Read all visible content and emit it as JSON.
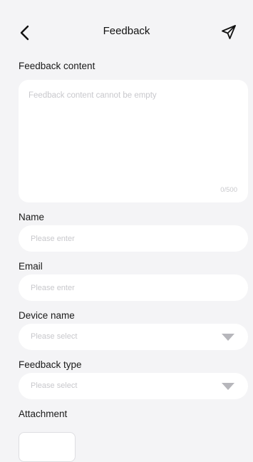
{
  "header": {
    "title": "Feedback",
    "back_icon": "chevron-left-icon",
    "send_icon": "send-icon"
  },
  "content": {
    "label": "Feedback content",
    "placeholder": "Feedback content cannot be empty",
    "value": "",
    "counter": "0/500"
  },
  "name": {
    "label": "Name",
    "placeholder": "Please enter",
    "value": ""
  },
  "email": {
    "label": "Email",
    "placeholder": "Please enter",
    "value": ""
  },
  "device": {
    "label": "Device name",
    "placeholder": "Please select",
    "icon": "dropdown-arrow-icon"
  },
  "feedback_type": {
    "label": "Feedback type",
    "placeholder": "Please select",
    "icon": "dropdown-arrow-icon"
  },
  "attachment": {
    "label": "Attachment"
  }
}
